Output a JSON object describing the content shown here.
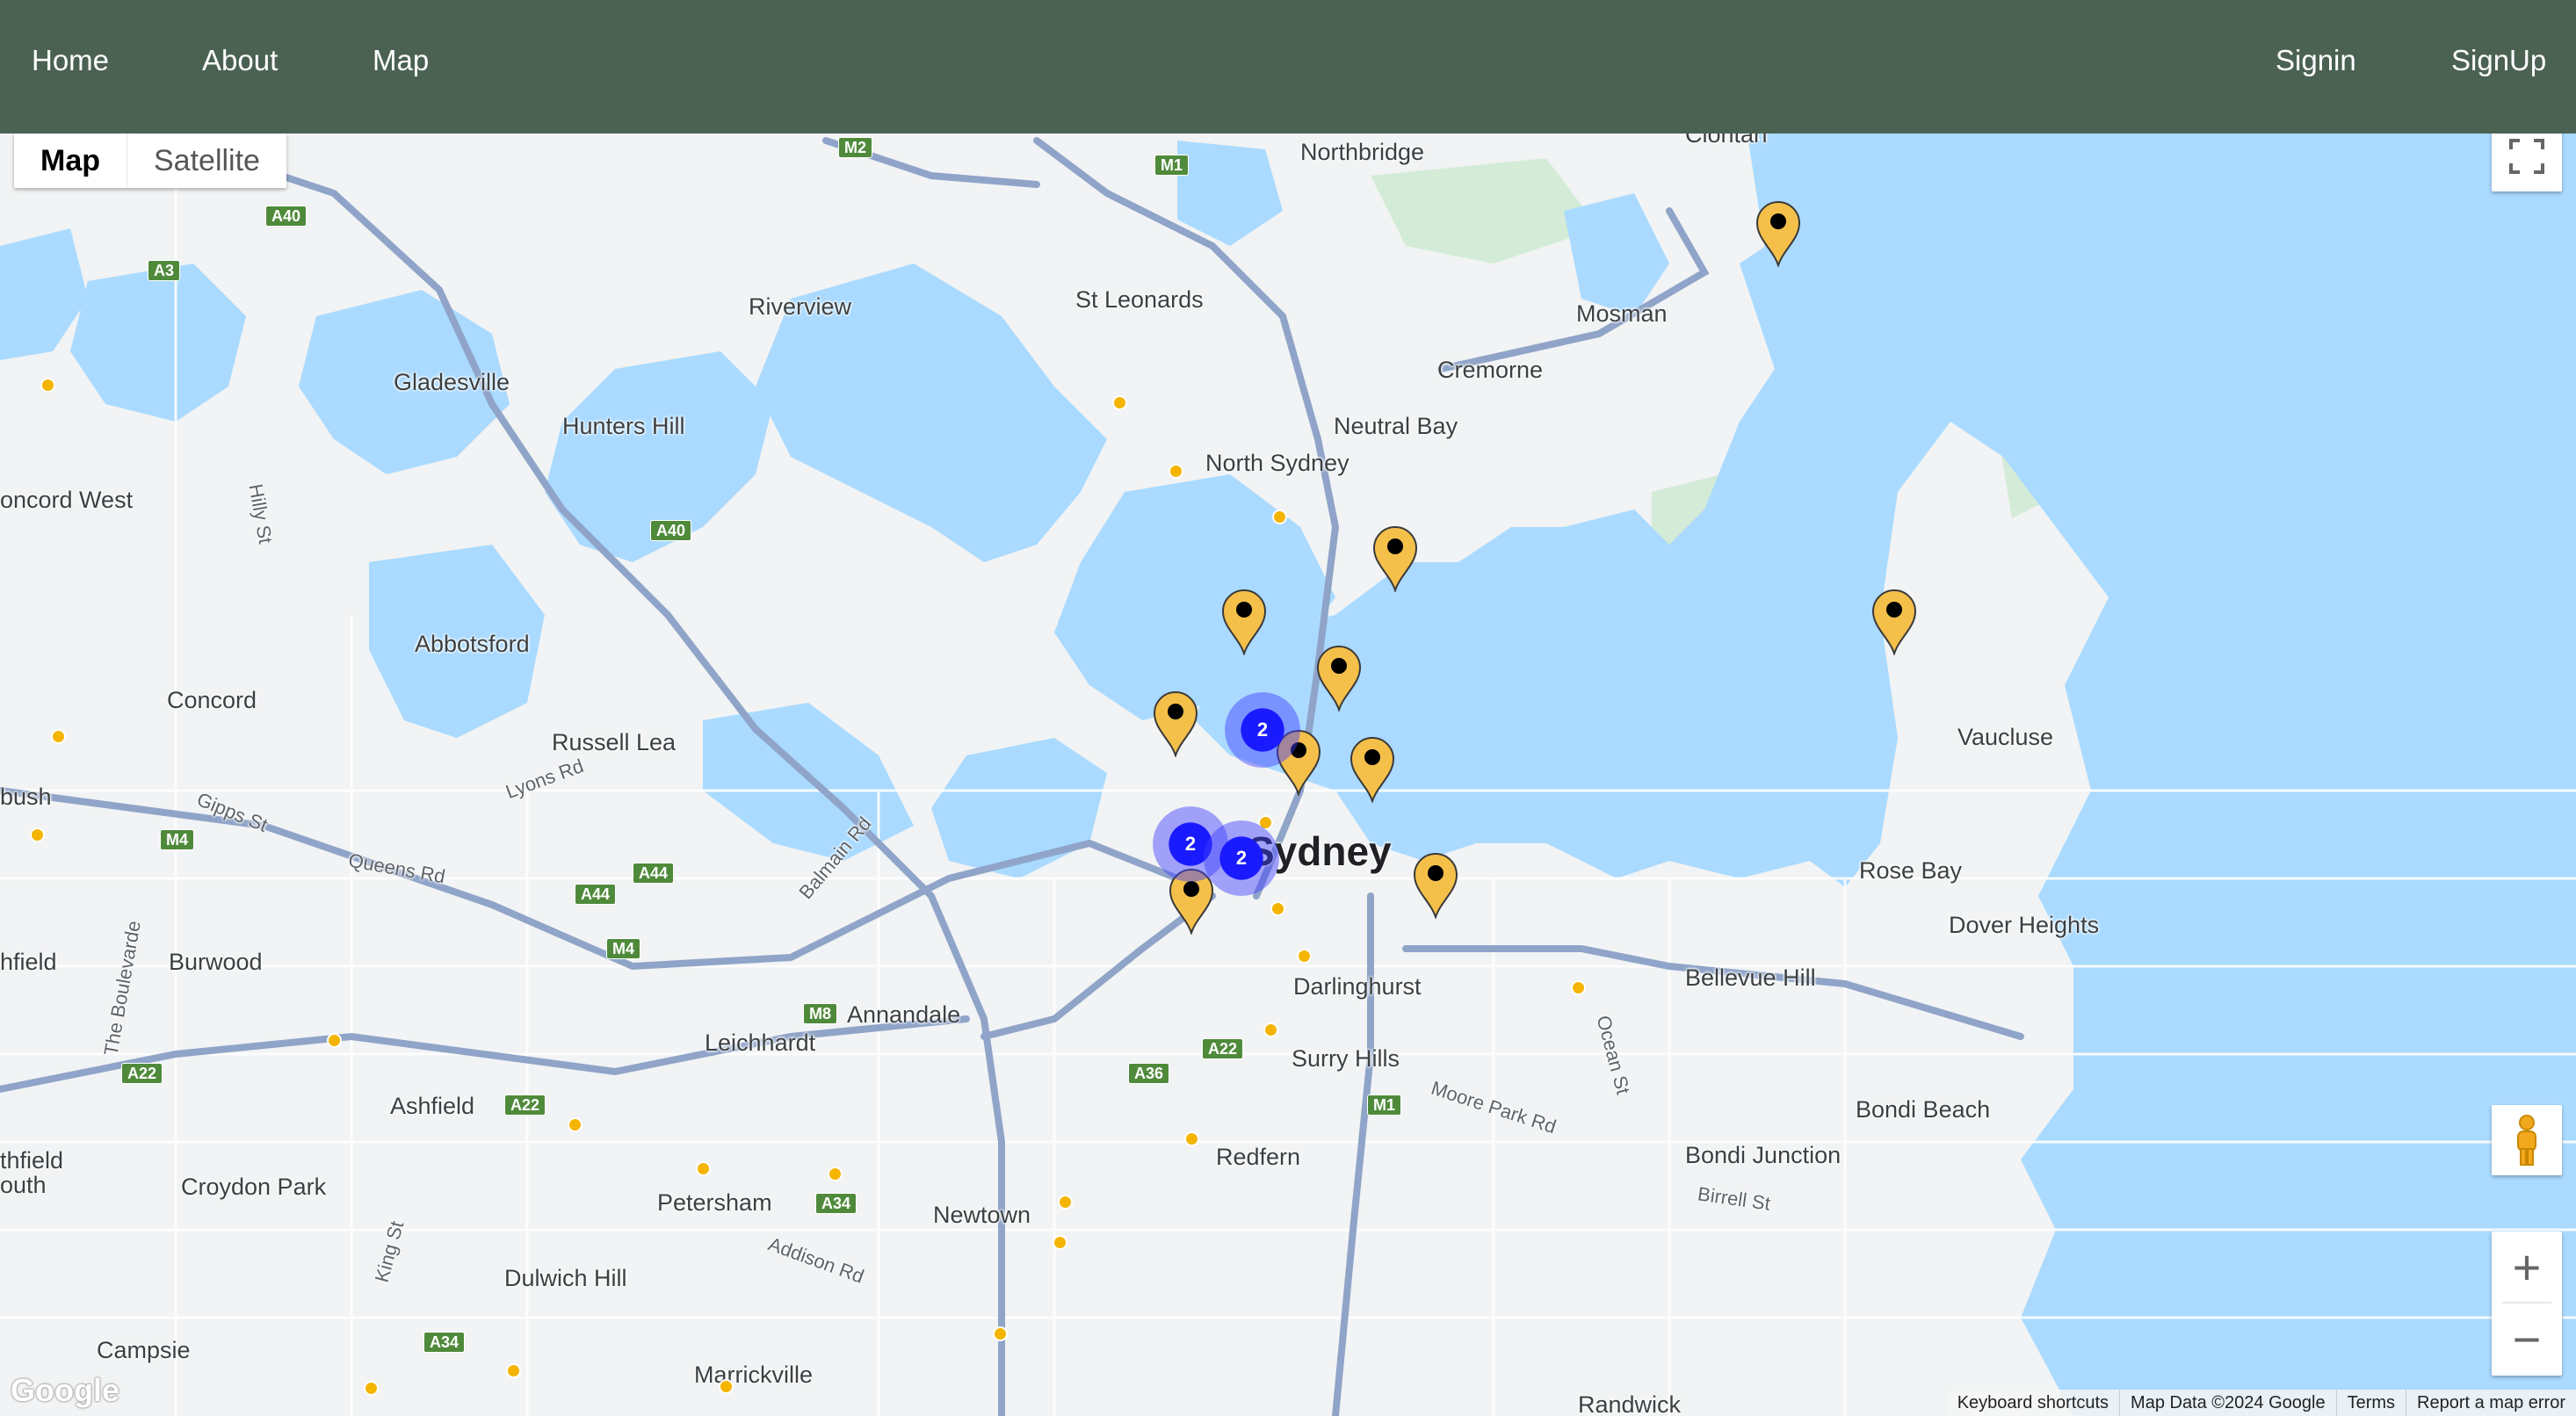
{
  "nav": {
    "home": "Home",
    "about": "About",
    "map": "Map",
    "signin": "Signin",
    "signup": "SignUp"
  },
  "map_controls": {
    "map_type_map": "Map",
    "map_type_satellite": "Satellite",
    "zoom_in": "+",
    "zoom_out": "−"
  },
  "map_footer": {
    "logo": "Google",
    "keyboard_shortcuts": "Keyboard shortcuts",
    "map_data": "Map Data ©2024 Google",
    "terms": "Terms",
    "report": "Report a map error"
  },
  "places": [
    "Clontarf",
    "Northbridge",
    "Riverview",
    "St Leonards",
    "Mosman",
    "Cremorne",
    "Gladesville",
    "Hunters Hill",
    "Neutral Bay",
    "North Sydney",
    "oncord West",
    "Abbotsford",
    "Concord",
    "Russell Lea",
    "Vaucluse",
    "bush",
    "Rose Bay",
    "Dover Heights",
    "Sydney",
    "hfield",
    "Burwood",
    "Annandale",
    "Darlinghurst",
    "Bellevue Hill",
    "Leichhardt",
    "Surry Hills",
    "Ashfield",
    "Bondi Beach",
    "Redfern",
    "Bondi Junction",
    "Croydon Park",
    "thfield",
    "outh",
    "Petersham",
    "Newtown",
    "Dulwich Hill",
    "Campsie",
    "Marrickville",
    "Randwick"
  ],
  "streets": [
    "Hilly St",
    "Lyons Rd",
    "Gipps St",
    "Queens Rd",
    "Balmain Rd",
    "The Boulevarde",
    "King St",
    "Addison Rd",
    "Moore Park Rd",
    "Ocean St",
    "Birrell St"
  ],
  "road_shields": [
    "M2",
    "M1",
    "A40",
    "A3",
    "A40",
    "M4",
    "A44",
    "A44",
    "M4",
    "M8",
    "A22",
    "A36",
    "A22",
    "A22",
    "M1",
    "A34",
    "A34"
  ],
  "clusters": [
    "2",
    "2",
    "2"
  ],
  "colors": {
    "navbar": "#4b6253",
    "water": "#aadaff",
    "land": "#f1f3f4",
    "park": "#d4ecd7",
    "highway": "#8fa4c8",
    "marker": "#f5c04a",
    "cluster": "#1a1aff"
  }
}
